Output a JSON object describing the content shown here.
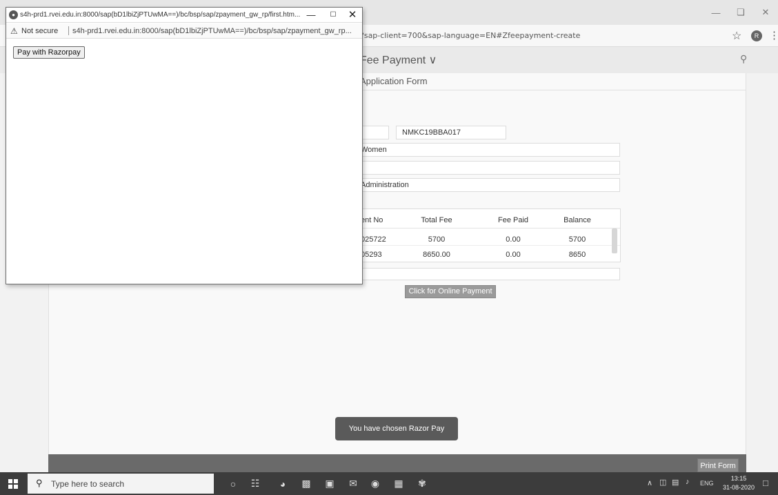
{
  "background_browser": {
    "url_fragment": "?sap-client=700&sap-language=EN#Zfeepayment-create",
    "profile_initial": "R",
    "app_title": "Fee Payment",
    "section_title": "Application Form",
    "fields": {
      "reg_no": "NMKC19BBA017",
      "college": "Women",
      "course": "Administration"
    },
    "table": {
      "headers": [
        "ent No",
        "Total Fee",
        "Fee Paid",
        "Balance"
      ],
      "rows": [
        [
          "025722",
          "5700",
          "0.00",
          "5700"
        ],
        [
          "05293",
          "8650.00",
          "0.00",
          "8650"
        ]
      ]
    },
    "online_payment_button": "Click for Online Payment",
    "toast": "You have chosen Razor Pay",
    "print_button": "Print Form"
  },
  "popup": {
    "title": "s4h-prd1.rvei.edu.in:8000/sap(bD1lbiZjPTUwMA==)/bc/bsp/sap/zpayment_gw_rp/first.htm...",
    "not_secure": "Not secure",
    "url": "s4h-prd1.rvei.edu.in:8000/sap(bD1lbiZjPTUwMA==)/bc/bsp/sap/zpayment_gw_rp...",
    "pay_button": "Pay with Razorpay"
  },
  "taskbar": {
    "search_placeholder": "Type here to search",
    "language": "ENG",
    "time": "13:15",
    "date": "31-08-2020"
  }
}
